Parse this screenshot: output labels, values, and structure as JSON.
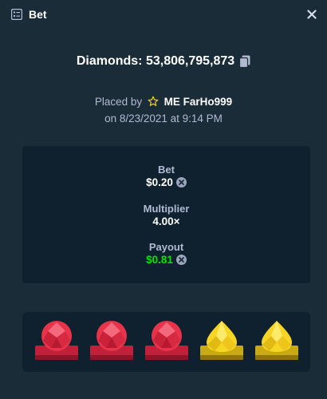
{
  "header": {
    "title": "Bet"
  },
  "bet": {
    "id_text": "Diamonds: 53,806,795,873"
  },
  "placed": {
    "prefix": "Placed by",
    "username": "ME FarHo999",
    "date_line": "on 8/23/2021 at 9:14 PM"
  },
  "stats": {
    "bet_label": "Bet",
    "bet_value": "$0.20",
    "multiplier_label": "Multiplier",
    "multiplier_value": "4.00×",
    "payout_label": "Payout",
    "payout_value": "$0.81"
  },
  "gems": [
    {
      "color": "red"
    },
    {
      "color": "red"
    },
    {
      "color": "red"
    },
    {
      "color": "yellow"
    },
    {
      "color": "yellow"
    }
  ],
  "colors": {
    "background": "#1a2c38",
    "panel": "#0f212e",
    "muted_text": "#b1bad3",
    "payout_green": "#00e701",
    "red_gem": "#e8334a",
    "red_base": "#c0213a",
    "yellow_gem": "#f6d523",
    "yellow_base": "#c9a916"
  }
}
